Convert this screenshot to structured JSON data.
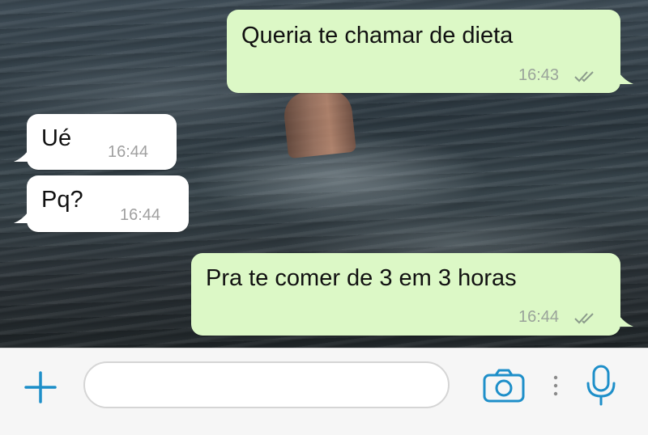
{
  "messages": [
    {
      "direction": "outgoing",
      "text": "Queria te chamar de dieta",
      "time": "16:43",
      "status": "read"
    },
    {
      "direction": "incoming",
      "text": "Ué",
      "time": "16:44"
    },
    {
      "direction": "incoming",
      "text": "Pq?",
      "time": "16:44"
    },
    {
      "direction": "outgoing",
      "text": "Pra te comer de 3 em 3 horas",
      "time": "16:44",
      "status": "read"
    }
  ],
  "composer": {
    "placeholder": "",
    "value": "",
    "icons": [
      "plus-icon",
      "camera-icon",
      "more-vertical-icon",
      "microphone-icon"
    ]
  },
  "colors": {
    "outgoing_bubble": "#dcf8c6",
    "incoming_bubble": "#ffffff",
    "accent": "#1e8fc9",
    "timestamp": "#9aa39a"
  }
}
